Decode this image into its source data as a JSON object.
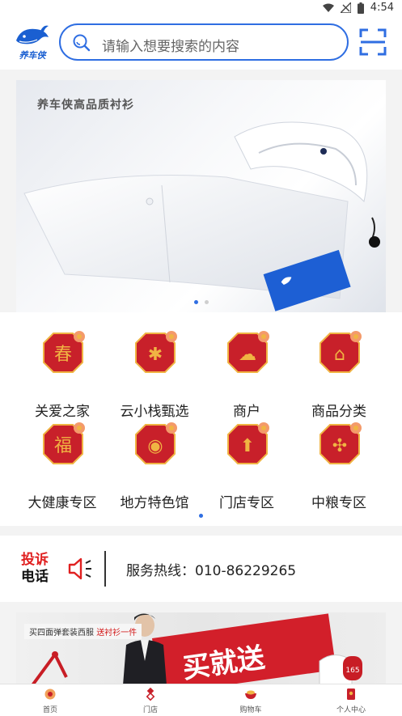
{
  "status_bar": {
    "time": "4:54"
  },
  "header": {
    "logo_text": "养车侠",
    "search_placeholder": "请输入想要搜索的内容"
  },
  "banner": {
    "caption": "养车侠高品质衬衫",
    "tag_text": "养车侠"
  },
  "categories": [
    {
      "label": "关爱之家",
      "glyph": "春",
      "icon": "spring-festival-icon"
    },
    {
      "label": "云小栈甄选",
      "glyph": "✱",
      "icon": "tree-ornament-icon"
    },
    {
      "label": "商户",
      "glyph": "☁",
      "icon": "auspicious-cloud-icon"
    },
    {
      "label": "商品分类",
      "glyph": "⌂",
      "icon": "temple-icon"
    },
    {
      "label": "大健康专区",
      "glyph": "福",
      "icon": "fu-character-icon"
    },
    {
      "label": "地方特色馆",
      "glyph": "◉",
      "icon": "lantern-icon"
    },
    {
      "label": "门店专区",
      "glyph": "⬆",
      "icon": "firework-icon"
    },
    {
      "label": "中粮专区",
      "glyph": "✣",
      "icon": "chinese-knot-icon"
    }
  ],
  "hotline": {
    "badge_line1": "投诉",
    "badge_line2": "电话",
    "text": "服务热线：010-86229265"
  },
  "promo": {
    "tag_prefix": "买四面弹套装西服 ",
    "tag_highlight": "送衬衫一件",
    "big_text": "买就送",
    "badge": "165"
  },
  "tabbar": [
    {
      "label": "首页",
      "icon": "home-icon"
    },
    {
      "label": "门店",
      "icon": "store-icon"
    },
    {
      "label": "购物车",
      "icon": "cart-icon"
    },
    {
      "label": "个人中心",
      "icon": "profile-icon"
    }
  ],
  "colors": {
    "accent": "#2f6ee2",
    "festive_red": "#c8202a",
    "gold": "#f0b443"
  }
}
